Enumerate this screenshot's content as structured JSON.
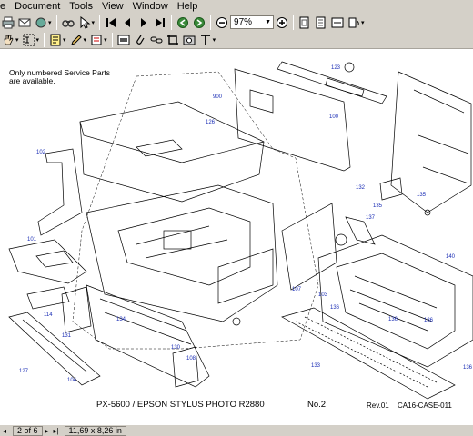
{
  "menu": [
    "e",
    "Document",
    "Tools",
    "View",
    "Window",
    "Help"
  ],
  "toolbar1": {
    "icons": [
      "print-icon",
      "email-icon",
      "search-icon",
      "select-icon",
      "first-page-icon",
      "prev-page-icon",
      "next-page-icon",
      "last-page-icon",
      "back-icon",
      "forward-icon",
      "zoom-out-icon",
      "zoom-in-icon",
      "actual-size-icon",
      "fit-page-icon",
      "fit-width-icon",
      "rotate-icon"
    ],
    "zoom_value": "97%"
  },
  "toolbar2": {
    "icons": [
      "hand-icon",
      "select-text-icon",
      "note-icon",
      "pencil-icon",
      "stamp-icon",
      "highlight-icon",
      "attach-icon",
      "link-icon",
      "crop-icon",
      "snapshot-icon",
      "text-tool-icon"
    ]
  },
  "page": {
    "note": "Only numbered Service Parts\nare available.",
    "title": "PX-5600 / EPSON STYLUS PHOTO R2880",
    "number": "No.2",
    "revision": "Rev.01",
    "code": "CA16-CASE-011",
    "part_labels": [
      "900",
      "126",
      "102",
      "100",
      "123",
      "101",
      "132",
      "135",
      "137",
      "140",
      "107",
      "103",
      "135",
      "136",
      "136",
      "136",
      "134",
      "114",
      "131",
      "130",
      "108",
      "127",
      "104",
      "133",
      "136"
    ]
  },
  "status": {
    "page_info": "2 of 6",
    "page_size": "11,69 x 8,26 in"
  }
}
